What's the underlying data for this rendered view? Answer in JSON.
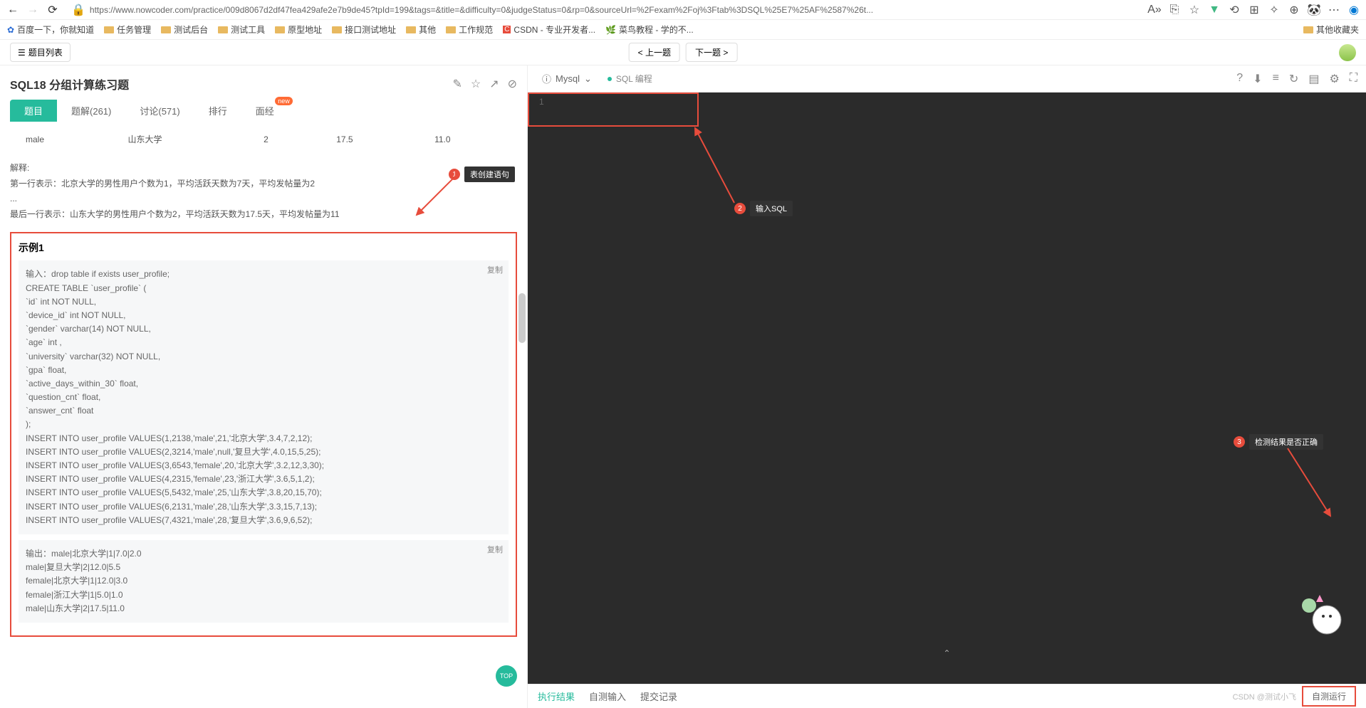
{
  "browser": {
    "url": "https://www.nowcoder.com/practice/009d8067d2df47fea429afe2e7b9de45?tpId=199&tags=&title=&difficulty=0&judgeStatus=0&rp=0&sourceUrl=%2Fexam%2Foj%3Ftab%3DSQL%25E7%25AF%2587%26t...",
    "read_aloud": "A»"
  },
  "bookmarks": {
    "baidu": "百度一下，你就知道",
    "b1": "任务管理",
    "b2": "测试后台",
    "b3": "测试工具",
    "b4": "原型地址",
    "b5": "接口测试地址",
    "b6": "其他",
    "b7": "工作规范",
    "csdn": "CSDN - 专业开发者...",
    "runoob": "菜鸟教程 - 学的不...",
    "right": "其他收藏夹"
  },
  "nav": {
    "list": "题目列表",
    "prev": "< 上一题",
    "next": "下一题 >"
  },
  "question": {
    "title": "SQL18 分组计算练习题"
  },
  "tabs": {
    "t1": "题目",
    "t2": "题解(261)",
    "t3": "讨论(571)",
    "t4": "排行",
    "t5": "面经",
    "badge": "new"
  },
  "table": {
    "c1": "male",
    "c2": "山东大学",
    "c3": "2",
    "c4": "17.5",
    "c5": "11.0"
  },
  "explain": {
    "h": "解释:",
    "l1": "第一行表示：北京大学的男性用户个数为1，平均活跃天数为7天，平均发帖量为2",
    "dots": "...",
    "l2": "最后一行表示：山东大学的男性用户个数为2，平均活跃天数为17.5天，平均发帖量为11"
  },
  "example": {
    "title": "示例1",
    "input_label": "输入：",
    "output_label": "输出：",
    "copy": "复制",
    "input": "drop table if exists user_profile;\nCREATE TABLE `user_profile` (\n`id` int NOT NULL,\n`device_id` int NOT NULL,\n`gender` varchar(14) NOT NULL,\n`age` int ,\n`university` varchar(32) NOT NULL,\n`gpa` float,\n`active_days_within_30` float,\n`question_cnt` float,\n`answer_cnt` float\n);\nINSERT INTO user_profile VALUES(1,2138,'male',21,'北京大学',3.4,7,2,12);\nINSERT INTO user_profile VALUES(2,3214,'male',null,'复旦大学',4.0,15,5,25);\nINSERT INTO user_profile VALUES(3,6543,'female',20,'北京大学',3.2,12,3,30);\nINSERT INTO user_profile VALUES(4,2315,'female',23,'浙江大学',3.6,5,1,2);\nINSERT INTO user_profile VALUES(5,5432,'male',25,'山东大学',3.8,20,15,70);\nINSERT INTO user_profile VALUES(6,2131,'male',28,'山东大学',3.3,15,7,13);\nINSERT INTO user_profile VALUES(7,4321,'male',28,'复旦大学',3.6,9,6,52);",
    "output": "male|北京大学|1|7.0|2.0\nmale|复旦大学|2|12.0|5.5\nfemale|北京大学|1|12.0|3.0\nfemale|浙江大学|1|5.0|1.0\nmale|山东大学|2|17.5|11.0"
  },
  "editor": {
    "db": "Mysql",
    "sql_label": "SQL 编程",
    "line1": "1"
  },
  "annotations": {
    "a1": "表创建语句",
    "a2": "输入SQL",
    "a3": "检测结果是否正确"
  },
  "bottom": {
    "t1": "执行结果",
    "t2": "自测输入",
    "t3": "提交记录",
    "selftest": "自测运行",
    "watermark": "CSDN @测试小飞"
  }
}
